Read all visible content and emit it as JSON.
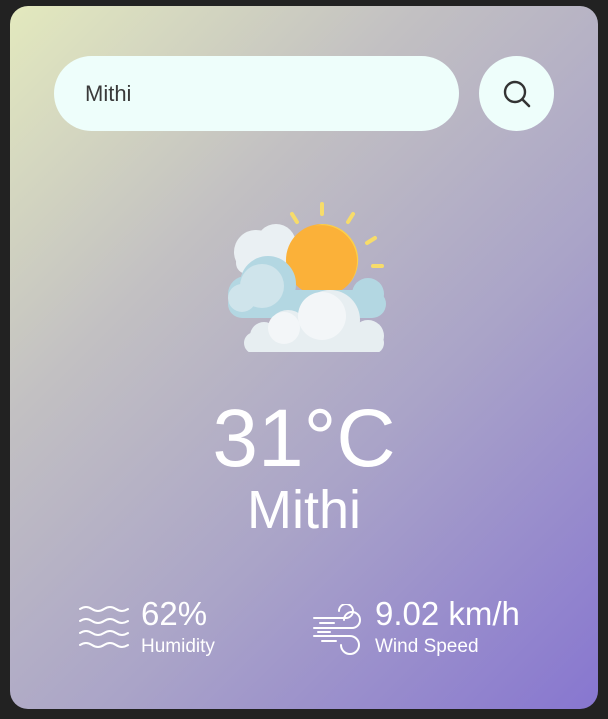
{
  "search": {
    "value": "Mithi",
    "icon": "search-icon"
  },
  "weather": {
    "icon": "partly-cloudy-sun-icon",
    "temperature": "31°C",
    "city": "Mithi"
  },
  "details": {
    "humidity": {
      "icon": "humidity-waves-icon",
      "value": "62%",
      "label": "Humidity"
    },
    "wind": {
      "icon": "wind-icon",
      "value": "9.02 km/h",
      "label": "Wind Speed"
    }
  },
  "colors": {
    "gradient_start": "#e3e9be",
    "gradient_end": "#8776d0",
    "field_background": "#eefefb",
    "text": "#ffffff",
    "page_background": "#222222"
  }
}
